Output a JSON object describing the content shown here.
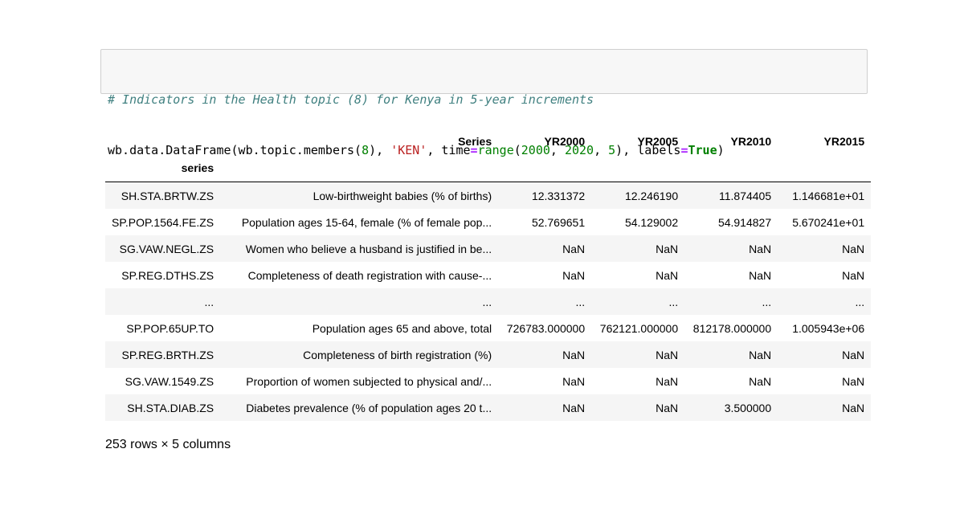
{
  "code": {
    "comment": "# Indicators in the Health topic (8) for Kenya in 5-year increments",
    "call": {
      "prefix": "wb.data.DataFrame(wb.topic.members(",
      "topic_num": "8",
      "sep1": "), ",
      "country": "'KEN'",
      "sep2": ", time",
      "eq1": "=",
      "range_fn": "range",
      "paren_open": "(",
      "start": "2000",
      "comma1": ", ",
      "end": "2020",
      "comma2": ", ",
      "step": "5",
      "sep3": "), labels",
      "eq2": "=",
      "true_kw": "True",
      "close": ")"
    }
  },
  "table": {
    "columns": [
      "Series",
      "YR2000",
      "YR2005",
      "YR2010",
      "YR2015"
    ],
    "index_name": "series",
    "rows": [
      {
        "index": "SH.STA.BRTW.ZS",
        "cells": [
          "Low-birthweight babies (% of births)",
          "12.331372",
          "12.246190",
          "11.874405",
          "1.146681e+01"
        ]
      },
      {
        "index": "SP.POP.1564.FE.ZS",
        "cells": [
          "Population ages 15-64, female (% of female pop...",
          "52.769651",
          "54.129002",
          "54.914827",
          "5.670241e+01"
        ]
      },
      {
        "index": "SG.VAW.NEGL.ZS",
        "cells": [
          "Women who believe a husband is justified in be...",
          "NaN",
          "NaN",
          "NaN",
          "NaN"
        ]
      },
      {
        "index": "SP.REG.DTHS.ZS",
        "cells": [
          "Completeness of death registration with cause-...",
          "NaN",
          "NaN",
          "NaN",
          "NaN"
        ]
      },
      {
        "index": "...",
        "cells": [
          "...",
          "...",
          "...",
          "...",
          "..."
        ]
      },
      {
        "index": "SP.POP.65UP.TO",
        "cells": [
          "Population ages 65 and above, total",
          "726783.000000",
          "762121.000000",
          "812178.000000",
          "1.005943e+06"
        ]
      },
      {
        "index": "SP.REG.BRTH.ZS",
        "cells": [
          "Completeness of birth registration (%)",
          "NaN",
          "NaN",
          "NaN",
          "NaN"
        ]
      },
      {
        "index": "SG.VAW.1549.ZS",
        "cells": [
          "Proportion of women subjected to physical and/...",
          "NaN",
          "NaN",
          "NaN",
          "NaN"
        ]
      },
      {
        "index": "SH.STA.DIAB.ZS",
        "cells": [
          "Diabetes prevalence (% of population ages 20 t...",
          "NaN",
          "NaN",
          "3.500000",
          "NaN"
        ]
      }
    ],
    "shape": "253 rows × 5 columns"
  }
}
